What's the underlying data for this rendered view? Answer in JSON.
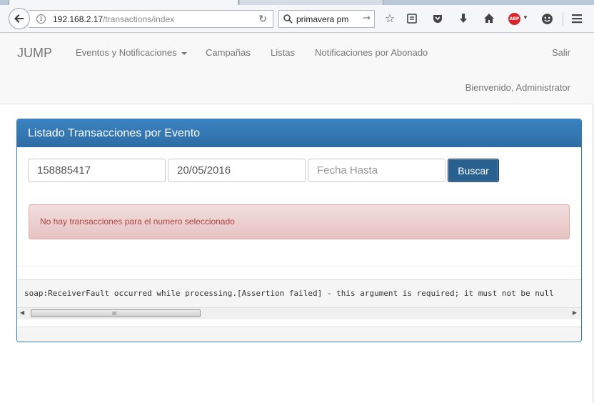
{
  "browser": {
    "url_host": "192.168.2.17",
    "url_path": "/transactions/index",
    "search_value": "primavera pm",
    "abp_label": "ABP"
  },
  "navbar": {
    "brand": "JUMP",
    "links": [
      {
        "label": "Eventos y Notificaciones",
        "has_caret": true
      },
      {
        "label": "Campañas"
      },
      {
        "label": "Listas"
      },
      {
        "label": "Notificaciones por Abonado"
      }
    ],
    "logout": "Salir",
    "welcome": "Bienvenido, Administrator"
  },
  "panel": {
    "title": "Listado Transacciones por Evento",
    "fields": {
      "numero_value": "158885417",
      "fecha_desde_value": "20/05/2016",
      "fecha_hasta_placeholder": "Fecha Hasta"
    },
    "search_button": "Buscar",
    "alert_text": "No hay transacciones para el numero seleccionado",
    "error_text": "soap:ReceiverFault occurred while processing.[Assertion failed] - this argument is required; it must not be null",
    "scroll_grip": "III"
  },
  "colors": {
    "primary": "#337ab7",
    "button": "#286090",
    "alert_bg": "#f2dede",
    "alert_text": "#a94442"
  }
}
